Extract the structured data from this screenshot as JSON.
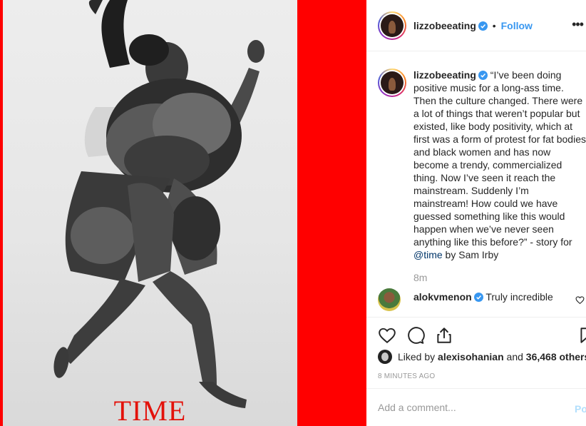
{
  "photo": {
    "magazine_title": "TIME",
    "background_color": "#ff0000",
    "title_color": "#e3120b"
  },
  "header": {
    "username": "lizzobeeating",
    "separator": "•",
    "follow_label": "Follow",
    "more_icon": "ellipsis-icon"
  },
  "caption": {
    "username": "lizzobeeating",
    "text_part1": "“I’ve been doing positive music for a long-ass time. Then the culture changed. There were a lot of things that weren’t popular but existed, like body positivity, which at first was a form of protest for fat bodies and black women and has now become a trendy, commercialized thing. Now I’ve seen it reach the mainstream. Suddenly I’m mainstream! How could we have guessed something like this would happen when we’ve never seen anything like this before?” - story for ",
    "mention": "@time",
    "text_part2": " by Sam Irby",
    "time_ago": "8m"
  },
  "comment": {
    "username": "alokvmenon",
    "text": "Truly incredible"
  },
  "actions": {
    "like_icon": "heart-icon",
    "comment_icon": "comment-icon",
    "share_icon": "share-icon",
    "save_icon": "bookmark-icon"
  },
  "likes": {
    "prefix": "Liked by ",
    "first_user": "alexisohanian",
    "middle": " and ",
    "count_text": "36,468 others"
  },
  "timestamp": "8 MINUTES AGO",
  "comment_box": {
    "placeholder": "Add a comment...",
    "post_label": "Post"
  },
  "colors": {
    "link_blue": "#3897f0",
    "mention_blue": "#003569",
    "muted": "#999999",
    "verified_blue": "#3897f0"
  }
}
